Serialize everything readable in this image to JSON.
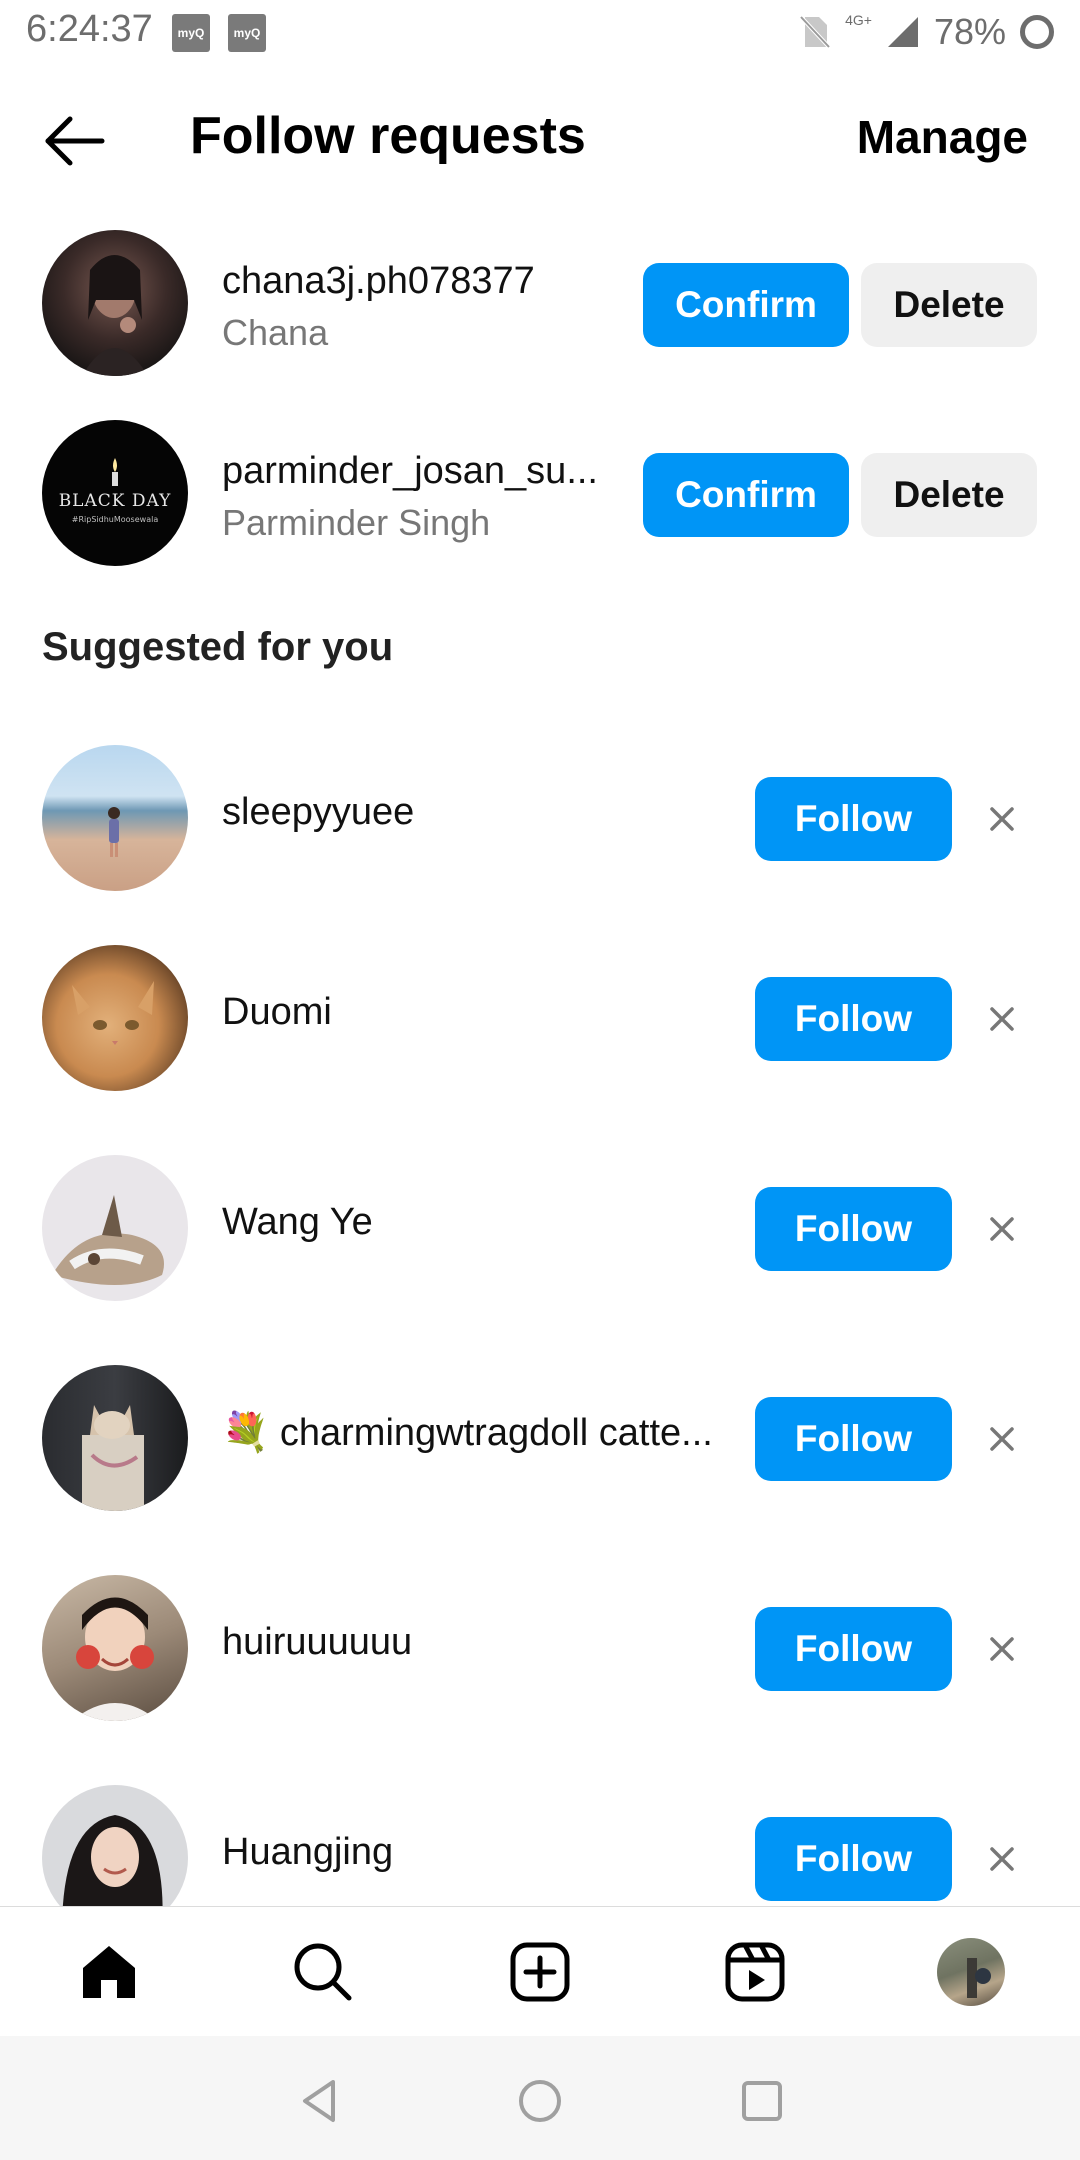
{
  "status_bar": {
    "time": "6:24:37",
    "myq_label": "myQ",
    "network": "4G+",
    "battery": "78%"
  },
  "header": {
    "title": "Follow requests",
    "manage_label": "Manage"
  },
  "requests": [
    {
      "username": "chana3j.ph078377",
      "full_name": "Chana",
      "confirm_label": "Confirm",
      "delete_label": "Delete"
    },
    {
      "username": "parminder_josan_su...",
      "full_name": "Parminder Singh",
      "confirm_label": "Confirm",
      "delete_label": "Delete",
      "avatar_text": "BLACK DAY",
      "avatar_subtext": "#RipSidhuMoosewala"
    }
  ],
  "suggested": {
    "title": "Suggested for you",
    "items": [
      {
        "username": "sleepyyuee",
        "follow_label": "Follow"
      },
      {
        "username": "Duomi",
        "follow_label": "Follow"
      },
      {
        "username": "Wang Ye",
        "follow_label": "Follow"
      },
      {
        "username": "💐 charmingwtragdoll catte...",
        "follow_label": "Follow"
      },
      {
        "username": "huiruuuuuu",
        "follow_label": "Follow"
      },
      {
        "username": "Huangjing",
        "follow_label": "Follow"
      }
    ]
  },
  "bottom_nav": {
    "items": [
      "home-icon",
      "search-icon",
      "create-icon",
      "reels-icon",
      "profile-avatar"
    ]
  },
  "colors": {
    "accent": "#0095f6",
    "delete_bg": "#efefef"
  }
}
